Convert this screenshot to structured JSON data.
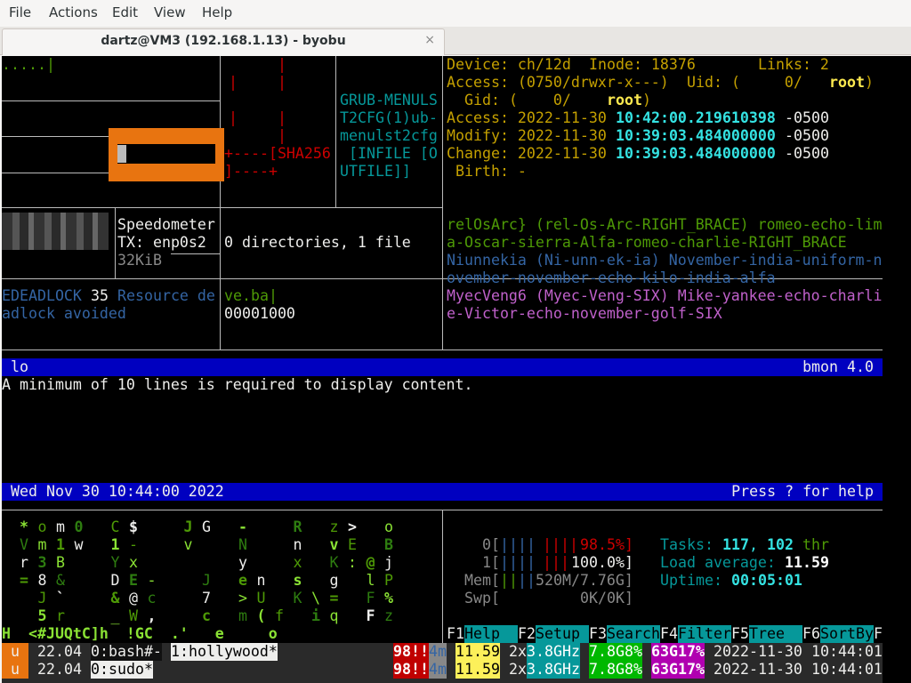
{
  "menubar": {
    "file": "File",
    "actions": "Actions",
    "edit": "Edit",
    "view": "View",
    "help": "Help"
  },
  "tab": {
    "title": "dartz@VM3 (192.168.1.13) - byobu",
    "close_glyph": "×"
  },
  "pane1": {
    "dots": ".....|",
    "pipe": "|",
    "sha": "+----[SHA256",
    "bottom": "]----+"
  },
  "grub": {
    "l1": "GRUB-MENULS",
    "l2": "T2CFG(1)ub-",
    "l3": "menulst2cfg",
    "l4": " [INFILE [O",
    "l5": "UTFILE]]"
  },
  "stat": {
    "device_label": "Device: ch/12d",
    "inode_label": "Inode: 18376",
    "links_label": "Links: 2",
    "access_label": "Access: (0750/drwxr-x---)",
    "uid_label": "Uid: (     0/",
    "uid_user": "root",
    "gid_label": "Gid: (    0/",
    "gid_user": "root",
    "atime_label": "Access: 2022-11-30 ",
    "atime": "10:42:00.219610398",
    "atz": " -0500",
    "mtime_label": "Modify: 2022-11-30 ",
    "mtime": "10:39:03.484000000",
    "mtz": " -0500",
    "ctime_label": "Change: 2022-11-30 ",
    "ctime": "10:39:03.484000000",
    "ctz": " -0500",
    "birth_label": "Birth: -"
  },
  "speedo": {
    "title": "Speedometer",
    "tx": "TX: enp0s2",
    "size": "32KiB"
  },
  "tree": {
    "summary": "0 directories, 1 file"
  },
  "nato": {
    "l1": "relOsArc} (rel-Os-Arc-RIGHT_BRACE) romeo-echo-lim",
    "l2": "a-Oscar-sierra-Alfa-romeo-charlie-RIGHT_BRACE",
    "l3": "Niunnekia (Ni-unn-ek-ia) November-india-uniform-n",
    "l4": "ovember-november-echo-kilo-india-alfa",
    "l5": "MyecVeng6 (Myec-Veng-SIX) Mike-yankee-echo-charli",
    "l6": "e-Victor-echo-november-golf-SIX"
  },
  "errno": {
    "code": "EDEADLOCK",
    "num": " 35 ",
    "text": "Resource de",
    "l2": "adlock avoided"
  },
  "hexv": {
    "l1": "ve.ba|",
    "l2": "00001000"
  },
  "bmon": {
    "iface": "lo",
    "title": "bmon 4.0",
    "message": "A minimum of 10 lines is required to display content.",
    "date": "Wed Nov 30 10:44:00 2022",
    "help": "Press ? for help"
  },
  "matrix": {
    "rows": [
      [
        "*",
        "o",
        "m",
        "0",
        "",
        "C",
        "$",
        "",
        "",
        "J",
        "G",
        "",
        "-",
        "",
        "",
        "R",
        "",
        "z",
        "&gt;",
        "",
        "o"
      ],
      [
        "V",
        "m",
        "1",
        "w",
        "",
        "1",
        "-",
        "",
        "",
        "v",
        "",
        "",
        "N",
        "",
        "",
        "n",
        "",
        "v",
        "E",
        "",
        "B"
      ],
      [
        "r",
        "3",
        "B",
        "",
        "",
        "Y",
        "x",
        "",
        "",
        "",
        "",
        "",
        "y",
        "",
        "",
        "x",
        "",
        "K",
        ":",
        "@",
        "j"
      ],
      [
        "=",
        "8",
        "&",
        "",
        "",
        "D",
        "E",
        "-",
        "",
        "",
        "J",
        "",
        "e",
        "n",
        "",
        "s",
        "",
        "g",
        "",
        "l",
        "P"
      ],
      [
        "",
        "J",
        "`",
        "",
        "",
        "&",
        "@",
        "c",
        "",
        "",
        "7",
        "",
        "&gt;",
        "U",
        "",
        "K",
        "\\",
        "=",
        "",
        "F",
        "%"
      ],
      [
        "",
        "5",
        "r",
        "",
        "",
        "_",
        "W",
        ",",
        "",
        "",
        "c",
        "",
        "m",
        "(",
        "f",
        "",
        "i",
        "q",
        "",
        "F",
        "z"
      ]
    ],
    "bottom": "H  <#JUQtC]h  !GC  .'   e     o"
  },
  "htop": {
    "cpu0_label": "0[",
    "cpu0": "98.5%]",
    "cpu1_label": "1[",
    "cpu1": "100.0%]",
    "mem_label": "Mem[",
    "mem": "520M/7.76G]",
    "swp_label": "Swp[",
    "swp": "0K/0K]",
    "tasks_label": "Tasks: ",
    "tasks": "117",
    "tasks_sep": ", ",
    "threads": "102",
    "thr": " thr",
    "load_label": "Load average: ",
    "load": "11.59",
    "up_label": "Uptime: ",
    "uptime": "00:05:01",
    "fkeys": [
      {
        "k": "F1",
        "l": "Help  "
      },
      {
        "k": "F2",
        "l": "Setup "
      },
      {
        "k": "F3",
        "l": "Search"
      },
      {
        "k": "F4",
        "l": "Filter"
      },
      {
        "k": "F5",
        "l": "Tree  "
      },
      {
        "k": "F6",
        "l": "SortBy"
      },
      {
        "k": "F",
        "l": ""
      }
    ]
  },
  "status": {
    "row1": {
      "u": "u",
      "ver": "22.04",
      "win0": "0:bash#-",
      "win1": "1:hollywood*",
      "alert": "98!!",
      "mins": "4m",
      "load": "11.59",
      "cpu": "2x",
      "ghz": "3.8GHz",
      "mem": "7.8G8%",
      "disk": "63G17%",
      "date": "2022-11-30",
      "time": "10:44:01"
    },
    "row2": {
      "u": "u",
      "ver": "22.04",
      "win0": "0:sudo*",
      "alert": "98!!",
      "mins": "4m",
      "load": "11.59",
      "cpu": "2x",
      "ghz": "3.8GHz",
      "mem": "7.8G8%",
      "disk": "63G17%",
      "date": "2022-11-30",
      "time": "10:44:01"
    }
  },
  "colors": {
    "terminal_bg": "#000000",
    "bmon_bar": "#0000c0",
    "orange": "#e87410",
    "status_red": "#c00000",
    "status_yellow": "#fcf05a",
    "status_green": "#00b800",
    "status_magenta": "#b000b0"
  }
}
